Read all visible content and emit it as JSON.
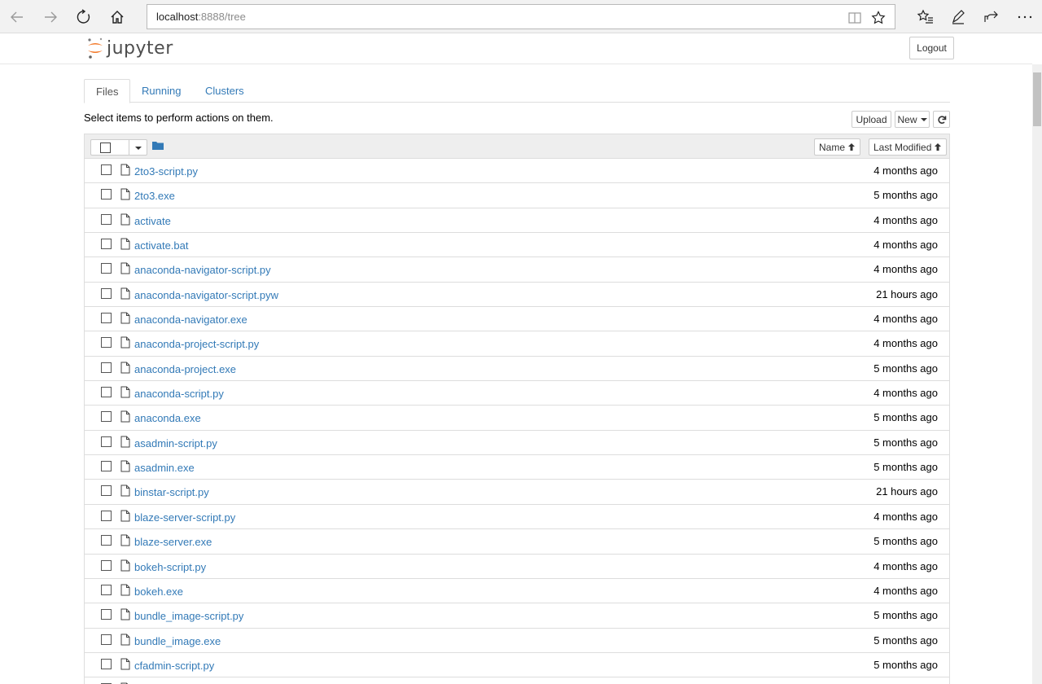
{
  "browser": {
    "url_host": "localhost",
    "url_rest": ":8888/tree"
  },
  "header": {
    "logo_text": "jupyter",
    "logout_label": "Logout"
  },
  "tabs": [
    {
      "label": "Files",
      "active": true
    },
    {
      "label": "Running",
      "active": false
    },
    {
      "label": "Clusters",
      "active": false
    }
  ],
  "toolbar": {
    "message": "Select items to perform actions on them.",
    "upload_label": "Upload",
    "new_label": "New"
  },
  "list_header": {
    "name_label": "Name",
    "modified_label": "Last Modified"
  },
  "files": [
    {
      "name": "2to3-script.py",
      "modified": "4 months ago"
    },
    {
      "name": "2to3.exe",
      "modified": "5 months ago"
    },
    {
      "name": "activate",
      "modified": "4 months ago"
    },
    {
      "name": "activate.bat",
      "modified": "4 months ago"
    },
    {
      "name": "anaconda-navigator-script.py",
      "modified": "4 months ago"
    },
    {
      "name": "anaconda-navigator-script.pyw",
      "modified": "21 hours ago"
    },
    {
      "name": "anaconda-navigator.exe",
      "modified": "4 months ago"
    },
    {
      "name": "anaconda-project-script.py",
      "modified": "4 months ago"
    },
    {
      "name": "anaconda-project.exe",
      "modified": "5 months ago"
    },
    {
      "name": "anaconda-script.py",
      "modified": "4 months ago"
    },
    {
      "name": "anaconda.exe",
      "modified": "5 months ago"
    },
    {
      "name": "asadmin-script.py",
      "modified": "5 months ago"
    },
    {
      "name": "asadmin.exe",
      "modified": "5 months ago"
    },
    {
      "name": "binstar-script.py",
      "modified": "21 hours ago"
    },
    {
      "name": "blaze-server-script.py",
      "modified": "4 months ago"
    },
    {
      "name": "blaze-server.exe",
      "modified": "5 months ago"
    },
    {
      "name": "bokeh-script.py",
      "modified": "4 months ago"
    },
    {
      "name": "bokeh.exe",
      "modified": "4 months ago"
    },
    {
      "name": "bundle_image-script.py",
      "modified": "5 months ago"
    },
    {
      "name": "bundle_image.exe",
      "modified": "5 months ago"
    },
    {
      "name": "cfadmin-script.py",
      "modified": "5 months ago"
    },
    {
      "name": "",
      "modified": ""
    }
  ]
}
